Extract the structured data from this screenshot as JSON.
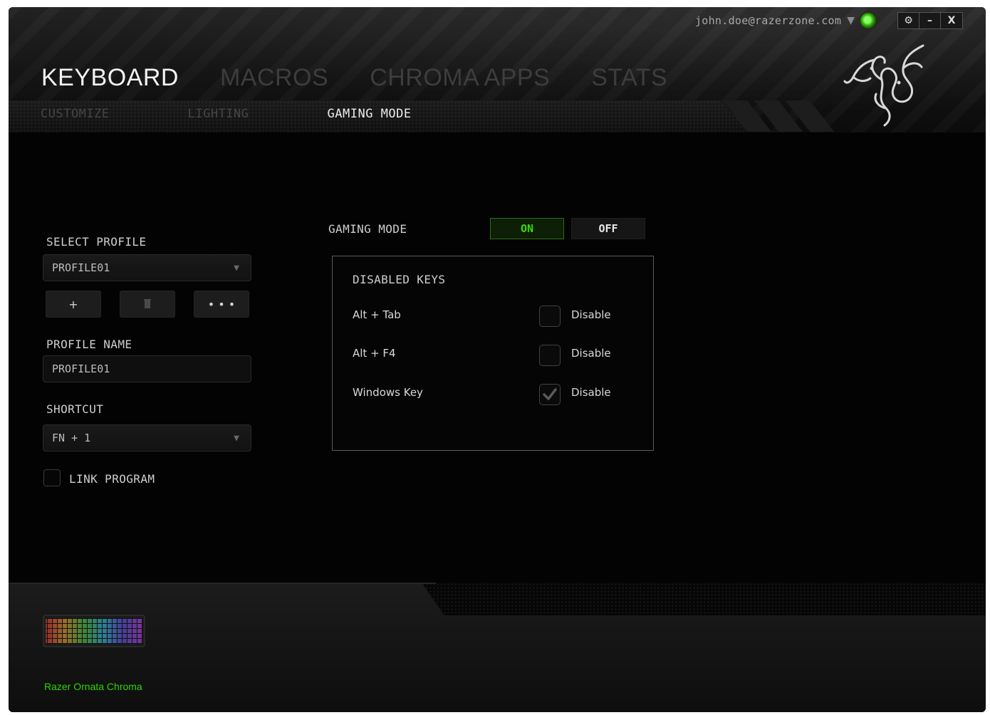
{
  "header": {
    "user_email": "john.doe@razerzone.com",
    "main_tabs": [
      {
        "label": "KEYBOARD",
        "active": true
      },
      {
        "label": "MACROS",
        "active": false
      },
      {
        "label": "CHROMA APPS",
        "active": false
      },
      {
        "label": "STATS",
        "active": false
      }
    ],
    "sub_tabs": [
      {
        "label": "CUSTOMIZE",
        "active": false
      },
      {
        "label": "LIGHTING",
        "active": false
      },
      {
        "label": "GAMING MODE",
        "active": true
      }
    ],
    "window_buttons": {
      "settings": "⚙",
      "minimize": "–",
      "close": "X"
    }
  },
  "profile": {
    "select_label": "SELECT PROFILE",
    "selected": "PROFILE01",
    "buttons": {
      "add": "+",
      "more": "• • •"
    },
    "name_label": "PROFILE NAME",
    "name_value": "PROFILE01",
    "shortcut_label": "SHORTCUT",
    "shortcut_value": "FN + 1",
    "link_program_label": "LINK PROGRAM",
    "link_program_checked": false
  },
  "gaming_mode": {
    "label": "GAMING MODE",
    "on_label": "ON",
    "off_label": "OFF",
    "state": "on",
    "disabled_keys_title": "DISABLED KEYS",
    "keys": [
      {
        "name": "Alt + Tab",
        "action": "Disable",
        "checked": false
      },
      {
        "name": "Alt + F4",
        "action": "Disable",
        "checked": false
      },
      {
        "name": "Windows Key",
        "action": "Disable",
        "checked": true
      }
    ]
  },
  "device": {
    "name": "Razer Ornata Chroma"
  },
  "colors": {
    "accent_green": "#44d62c",
    "background": "#030303"
  }
}
